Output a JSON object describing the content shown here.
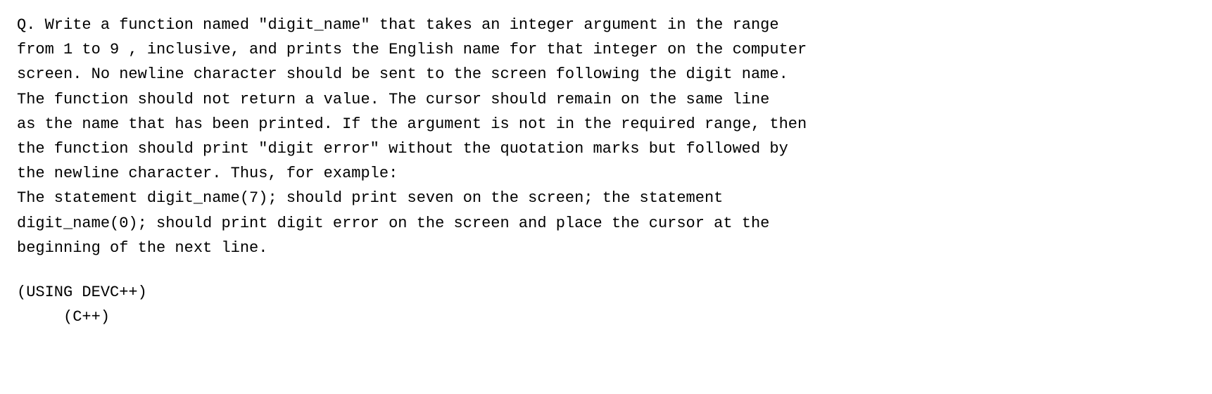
{
  "content": {
    "question_text": "Q. Write a function named \"digit_name\" that takes an integer argument in the range\nfrom 1 to 9 , inclusive, and prints the English name for that integer on the computer\nscreen. No newline character should be sent to the screen following the digit name.\nThe function should not return a value. The cursor should remain on the same line\nas the name that has been printed. If the argument is not in the required range, then\nthe function should print \"digit error\" without the quotation marks but followed by\nthe newline character. Thus, for example:\nThe statement digit_name(7); should print seven on the screen; the statement\ndigit_name(0); should print digit error on the screen and place the cursor at the\nbeginning of the next line.",
    "using_text": "(USING DEVC++)\n     (C++)"
  }
}
